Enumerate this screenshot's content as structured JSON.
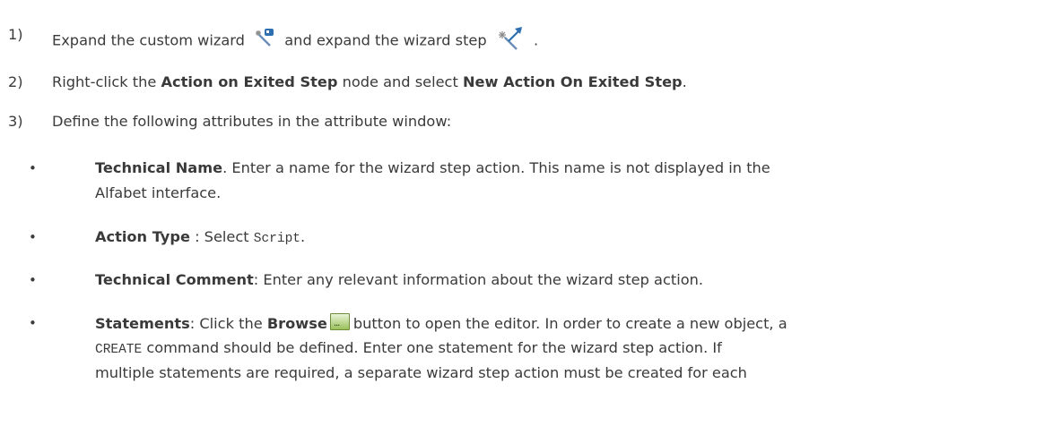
{
  "steps": [
    {
      "num": "1)",
      "text_a": "Expand the custom wizard",
      "icon_a": "custom-wizard-icon",
      "text_b": "and expand the wizard step",
      "icon_b": "wizard-step-icon",
      "text_c": "."
    },
    {
      "num": "2)",
      "text_a": "Right-click the ",
      "bold_a": "Action on Exited Step",
      "text_b": " node and select ",
      "bold_b": "New Action On Exited Step",
      "text_c": "."
    },
    {
      "num": "3)",
      "text": "Define the following attributes in the attribute window:"
    }
  ],
  "bullets": [
    {
      "bullet": "•",
      "bold": "Technical Name",
      "line1": ". Enter a name for the wizard step action. This name is not displayed in the",
      "line2": "Alfabet interface."
    },
    {
      "bullet": "•",
      "bold": "Action Type",
      "text_a": " : Select ",
      "code": "Script",
      "text_b": "."
    },
    {
      "bullet": "•",
      "bold": "Technical Comment",
      "text": ": Enter any relevant information about the wizard step action."
    },
    {
      "bullet": "•",
      "bold": "Statements",
      "text_a": ": Click the ",
      "bold_b": "Browse",
      "icon": "browse-ellipsis-icon",
      "text_b": "button to open the editor. In order to create a new object, a",
      "code": "CREATE",
      "line2": " command should be defined. Enter one statement for the wizard step action. If",
      "line3": "multiple statements are required, a separate wizard step action must be created for each"
    }
  ],
  "browse_icon_label": "..."
}
